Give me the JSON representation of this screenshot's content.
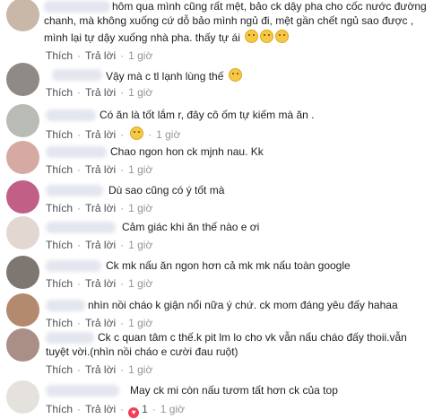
{
  "colors": {
    "link": "#4b4f56",
    "meta": "#90949c",
    "reaction": "#f33e58"
  },
  "actions": {
    "like": "Thích",
    "reply": "Trả lời",
    "sep": "·"
  },
  "comments": [
    {
      "lines": [
        "hôm qua mình cũng rất mệt, bảo ck dậy pha cho cốc nước đường",
        "chanh, mà không xuống cứ dỗ bảo mình ngủ đi, mệt gần chết ngủ sao được ,",
        "mình lại tự dậy xuống nhà pha. thấy tự ái"
      ],
      "emoji": [
        "confused-face-icon",
        "confused-face-icon",
        "confused-face-icon"
      ],
      "time": "1 giờ"
    },
    {
      "lines": [
        "Vậy mà c tl lạnh lùng thế"
      ],
      "emoji": [
        "grimace-face-icon"
      ],
      "time": "1 giờ"
    },
    {
      "lines": [
        "Có ăn là tốt lắm r, đây cô ốm tự kiếm mà ăn ."
      ],
      "time": "1 giờ",
      "reaction_emoji": "sad-face-icon"
    },
    {
      "lines": [
        "Chao ngon hon ck mjnh nau. Kk"
      ],
      "time": "1 giờ"
    },
    {
      "lines": [
        "Dù sao cũng có ý tốt mà"
      ],
      "time": "1 giờ"
    },
    {
      "lines": [
        "Cảm giác khi ăn thế nào e ơi"
      ],
      "time": "1 giờ"
    },
    {
      "lines": [
        "Ck mk nấu ăn ngon hơn cả mk mk nấu toàn google"
      ],
      "time": "1 giờ"
    },
    {
      "lines": [
        "nhìn nồi cháo k giận nổi nữa ý chứ. ck mom đáng yêu đấy hahaa"
      ],
      "time": "1 giờ"
    },
    {
      "lines": [
        "Ck c quan tâm c thế.k pit lm lo cho vk vẫn nấu cháo đấy thoii.vẫn",
        "tuyệt vời.(nhìn nồi cháo e cười đau ruột)"
      ],
      "time": "1 giờ"
    },
    {
      "lines": [
        "May ck mi còn nấu tươm tất hơn ck của top"
      ],
      "time": "1 giờ",
      "likes": "1"
    }
  ]
}
